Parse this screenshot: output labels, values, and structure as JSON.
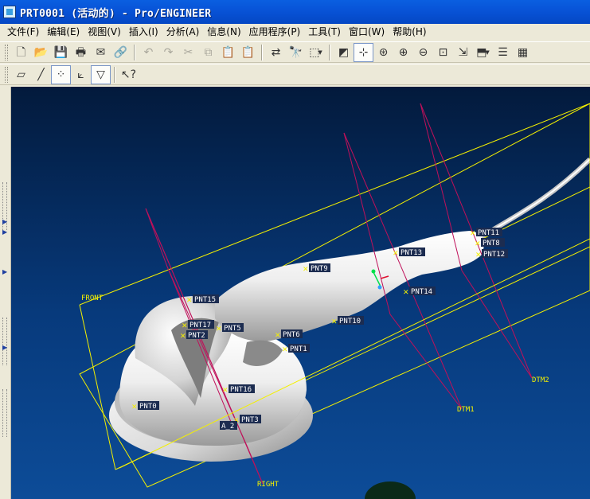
{
  "window": {
    "title": "PRT0001 (活动的) - Pro/ENGINEER"
  },
  "menu": [
    {
      "label": "文件(F)"
    },
    {
      "label": "编辑(E)"
    },
    {
      "label": "视图(V)"
    },
    {
      "label": "插入(I)"
    },
    {
      "label": "分析(A)"
    },
    {
      "label": "信息(N)"
    },
    {
      "label": "应用程序(P)"
    },
    {
      "label": "工具(T)"
    },
    {
      "label": "窗口(W)"
    },
    {
      "label": "帮助(H)"
    }
  ],
  "toolbar1": [
    {
      "icon": "new-file-icon",
      "glyph": "🗋"
    },
    {
      "icon": "open-folder-icon",
      "glyph": "📂"
    },
    {
      "icon": "save-icon",
      "glyph": "💾"
    },
    {
      "icon": "print-icon",
      "glyph": "🖶"
    },
    {
      "icon": "send-mail-icon",
      "glyph": "✉"
    },
    {
      "icon": "email-link-icon",
      "glyph": "🔗"
    },
    {
      "icon": "undo-icon",
      "glyph": "↶",
      "disabled": true
    },
    {
      "icon": "redo-icon",
      "glyph": "↷",
      "disabled": true
    },
    {
      "icon": "cut-icon",
      "glyph": "✂",
      "disabled": true
    },
    {
      "icon": "copy-icon",
      "glyph": "⧉",
      "disabled": true
    },
    {
      "icon": "paste-icon",
      "glyph": "📋",
      "disabled": true
    },
    {
      "icon": "paste-special-icon",
      "glyph": "📋",
      "disabled": true
    },
    {
      "icon": "regenerate-icon",
      "glyph": "⇄"
    },
    {
      "icon": "find-icon",
      "glyph": "🔭"
    },
    {
      "icon": "selection-box-icon",
      "glyph": "⬚",
      "dropdown": true
    },
    {
      "icon": "redraw-icon",
      "glyph": "◩"
    },
    {
      "icon": "spin-center-icon",
      "glyph": "⊹",
      "pressed": true
    },
    {
      "icon": "orient-mode-icon",
      "glyph": "⊛"
    },
    {
      "icon": "zoom-in-icon",
      "glyph": "⊕"
    },
    {
      "icon": "zoom-out-icon",
      "glyph": "⊖"
    },
    {
      "icon": "refit-icon",
      "glyph": "⊡"
    },
    {
      "icon": "reorient-icon",
      "glyph": "⇲"
    },
    {
      "icon": "saved-views-icon",
      "glyph": "⬒",
      "dropdown": true
    },
    {
      "icon": "layers-icon",
      "glyph": "☰"
    },
    {
      "icon": "model-display-icon",
      "glyph": "▦"
    }
  ],
  "toolbar2": [
    {
      "icon": "datum-planes-icon",
      "glyph": "▱"
    },
    {
      "icon": "datum-axes-icon",
      "glyph": "╱"
    },
    {
      "icon": "datum-points-icon",
      "glyph": "⁘",
      "pressed": true
    },
    {
      "icon": "coordinate-systems-icon",
      "glyph": "⟀"
    },
    {
      "icon": "annotation-display-icon",
      "glyph": "▽",
      "pressed": true
    },
    {
      "icon": "context-help-icon",
      "glyph": "↖?"
    }
  ],
  "datums": [
    {
      "label": "FRONT"
    },
    {
      "label": "RIGHT"
    },
    {
      "label": "DTM1"
    },
    {
      "label": "DTM2"
    },
    {
      "label": "A_2"
    }
  ],
  "points": [
    {
      "label": "PNT0"
    },
    {
      "label": "PNT1"
    },
    {
      "label": "PNT2"
    },
    {
      "label": "PNT3"
    },
    {
      "label": "PNT5"
    },
    {
      "label": "PNT6"
    },
    {
      "label": "PNT8"
    },
    {
      "label": "PNT9"
    },
    {
      "label": "PNT10"
    },
    {
      "label": "PNT11"
    },
    {
      "label": "PNT12"
    },
    {
      "label": "PNT13"
    },
    {
      "label": "PNT14"
    },
    {
      "label": "PNT15"
    },
    {
      "label": "PNT16"
    },
    {
      "label": "PNT17"
    }
  ],
  "colors": {
    "title_bar": "#0854d8",
    "viewport_top": "#031a3c",
    "viewport_bottom": "#0d4c98",
    "datum_plane": "#f4f000",
    "datum_edge": "#c0105a",
    "model": "#e8e8e8"
  }
}
